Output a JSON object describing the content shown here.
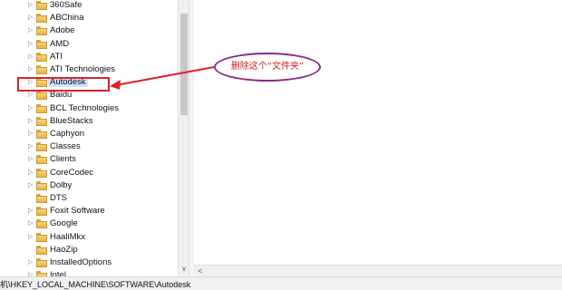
{
  "tree": {
    "items": [
      {
        "label": "360Safe"
      },
      {
        "label": "ABChina"
      },
      {
        "label": "Adobe"
      },
      {
        "label": "AMD"
      },
      {
        "label": "ATI"
      },
      {
        "label": "ATI Technologies"
      },
      {
        "label": "Autodesk",
        "selected": true
      },
      {
        "label": "Baidu"
      },
      {
        "label": "BCL Technologies"
      },
      {
        "label": "BlueStacks"
      },
      {
        "label": "Caphyon"
      },
      {
        "label": "Classes"
      },
      {
        "label": "Clients"
      },
      {
        "label": "CoreCodec"
      },
      {
        "label": "Dolby"
      },
      {
        "label": "DTS",
        "no_expander": true
      },
      {
        "label": "Foxit Software"
      },
      {
        "label": "Google"
      },
      {
        "label": "HaaliMkx"
      },
      {
        "label": "HaoZip",
        "no_expander": true
      },
      {
        "label": "InstalledOptions"
      },
      {
        "label": "Intel"
      }
    ]
  },
  "annotation": {
    "text": "删除这个“文件夹”",
    "accent_color": "#d41c22",
    "ellipse_color": "#8a2a8c"
  },
  "status_bar": {
    "path": "机\\HKEY_LOCAL_MACHINE\\SOFTWARE\\Autodesk"
  },
  "icons": {
    "folder": "folder-icon",
    "expander": "expand-arrow-icon"
  }
}
